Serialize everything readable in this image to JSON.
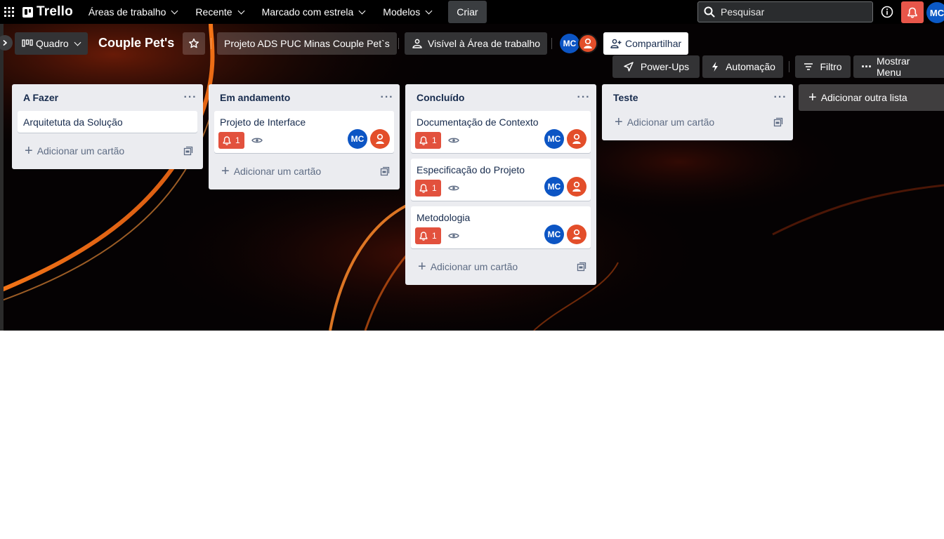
{
  "topnav": {
    "brand": "Trello",
    "menus": [
      "Áreas de trabalho",
      "Recente",
      "Marcado com estrela",
      "Modelos"
    ],
    "create_label": "Criar",
    "search_placeholder": "Pesquisar",
    "user_initials": "MC"
  },
  "board_header": {
    "view_label": "Quadro",
    "title": "Couple Pet's",
    "workspace_label": "Projeto ADS PUC Minas Couple Pet`s",
    "visibility_label": "Visível à Área de trabalho",
    "member_initials": "MC",
    "share_label": "Compartilhar"
  },
  "toolbar": {
    "powerups_label": "Power-Ups",
    "automation_label": "Automação",
    "filter_label": "Filtro",
    "menu_label": "Mostrar Menu"
  },
  "lists": [
    {
      "title": "A Fazer",
      "cards": [
        {
          "title": "Arquitetuta da Solução"
        }
      ],
      "add_card_label": "Adicionar um cartão"
    },
    {
      "title": "Em andamento",
      "cards": [
        {
          "title": "Projeto de Interface",
          "due_count": "1",
          "members": [
            "MC",
            "user"
          ]
        }
      ],
      "add_card_label": "Adicionar um cartão"
    },
    {
      "title": "Concluído",
      "cards": [
        {
          "title": "Documentação de Contexto",
          "due_count": "1",
          "members": [
            "MC",
            "user"
          ]
        },
        {
          "title": "Especificação do Projeto",
          "due_count": "1",
          "members": [
            "MC",
            "user"
          ]
        },
        {
          "title": "Metodologia",
          "due_count": "1",
          "members": [
            "MC",
            "user"
          ]
        }
      ],
      "add_card_label": "Adicionar um cartão"
    },
    {
      "title": "Teste",
      "cards": [],
      "add_card_label": "Adicionar um cartão"
    }
  ],
  "add_list_label": "Adicionar outra lista",
  "colors": {
    "topnav_bg": "#000000",
    "list_bg": "#ebecf0",
    "due_badge": "#e2513d",
    "avatar_blue": "#0c55c4",
    "avatar_orange": "#e34e2a",
    "notification": "#e8564a"
  }
}
